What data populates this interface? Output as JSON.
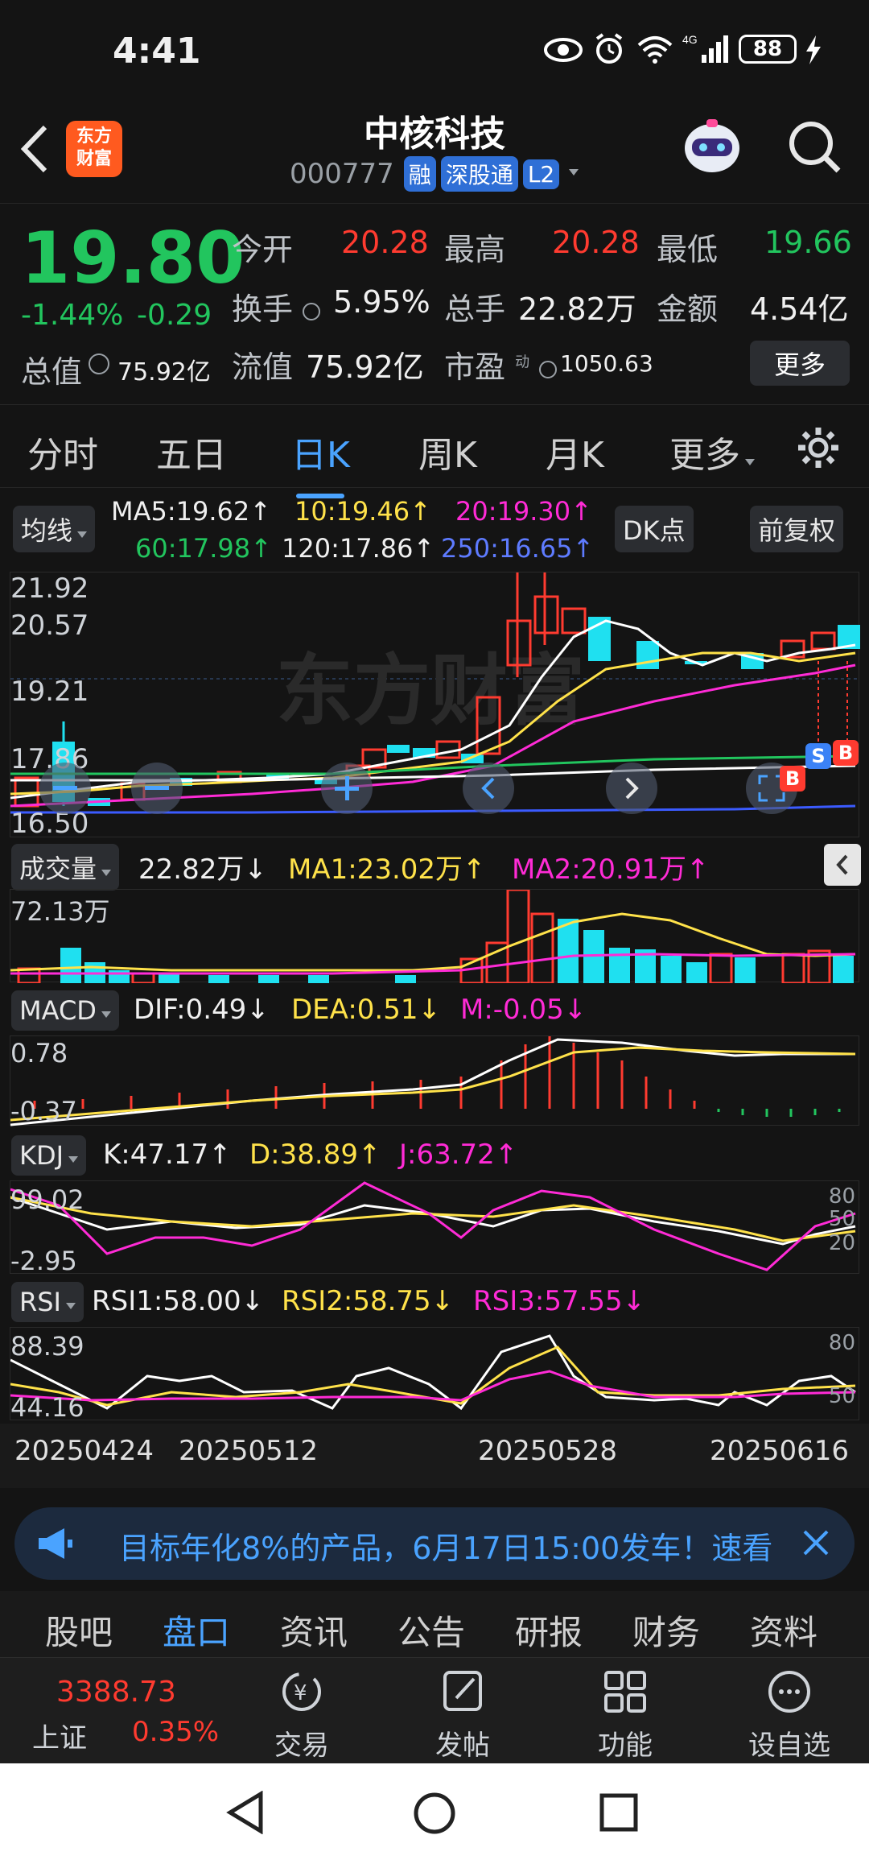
{
  "status_bar": {
    "time": "4:41",
    "battery": "88",
    "network": "4G"
  },
  "header": {
    "title": "中核科技",
    "code": "000777",
    "tags": [
      "融",
      "深股通",
      "L2"
    ],
    "logo_text_top": "东方",
    "logo_text_bottom": "财富"
  },
  "quote": {
    "price": "19.80",
    "change_pct": "-1.44%",
    "change_abs": "-0.29",
    "total_value_label": "总值",
    "total_value": "75.92亿",
    "stats": [
      {
        "label": "今开",
        "value": "20.28",
        "color": "#ff3b30"
      },
      {
        "label": "最高",
        "value": "20.28",
        "color": "#ff3b30"
      },
      {
        "label": "最低",
        "value": "19.66",
        "color": "#22c55e"
      },
      {
        "label": "换手",
        "value": "5.95%",
        "color": "#f0f0f0"
      },
      {
        "label": "总手",
        "value": "22.82万",
        "color": "#f0f0f0"
      },
      {
        "label": "金额",
        "value": "4.54亿",
        "color": "#f0f0f0"
      },
      {
        "label": "流值",
        "value": "75.92亿",
        "color": "#f0f0f0"
      },
      {
        "label": "市盈",
        "value": "1050.63",
        "color": "#f0f0f0"
      }
    ],
    "pe_sup": "动",
    "more_button": "更多"
  },
  "tabs": {
    "items": [
      "分时",
      "五日",
      "日K",
      "周K",
      "月K",
      "更多"
    ],
    "active": "日K"
  },
  "ma_panel": {
    "selector": "均线",
    "ma5": "MA5:19.62↑",
    "ma10": "10:19.46↑",
    "ma20": "20:19.30↑",
    "ma60": "60:17.98↑",
    "ma120": "120:17.86↑",
    "ma250": "250:16.65↑",
    "dk_button": "DK点",
    "fq_button": "前复权"
  },
  "kline": {
    "axis_labels": [
      "21.92",
      "20.57",
      "19.21",
      "17.86",
      "16.50"
    ],
    "watermark": "东方财富",
    "markers": {
      "s": "S",
      "b": "B"
    }
  },
  "volume": {
    "selector": "成交量",
    "value": "22.82万↓",
    "ma1": "MA1:23.02万↑",
    "ma2": "MA2:20.91万↑",
    "max_label": "72.13万"
  },
  "macd": {
    "selector": "MACD",
    "dif": "DIF:0.49↓",
    "dea": "DEA:0.51↓",
    "m": "M:-0.05↓",
    "top_label": "0.78",
    "bottom_label": "-0.37"
  },
  "kdj": {
    "selector": "KDJ",
    "k": "K:47.17↑",
    "d": "D:38.89↑",
    "j": "J:63.72↑",
    "top_label": "99.02",
    "bottom_label": "-2.95",
    "right_labels": [
      "80",
      "50",
      "20"
    ]
  },
  "rsi": {
    "selector": "RSI",
    "rsi1": "RSI1:58.00↓",
    "rsi2": "RSI2:58.75↓",
    "rsi3": "RSI3:57.55↓",
    "top_label": "88.39",
    "bottom_label": "44.16",
    "right_labels": [
      "80",
      "50"
    ]
  },
  "dates": [
    "20250424",
    "20250512",
    "20250528",
    "20250616"
  ],
  "banner": {
    "text": "目标年化8%的产品，6月17日15:00发车！速看"
  },
  "section_tabs": {
    "items": [
      "股吧",
      "盘口",
      "资讯",
      "公告",
      "研报",
      "财务",
      "资料"
    ],
    "active": "盘口"
  },
  "bottom_bar": {
    "index_value": "3388.73",
    "index_name": "上证",
    "index_change": "0.35%",
    "items": [
      "交易",
      "发帖",
      "功能",
      "设自选"
    ]
  },
  "colors": {
    "up": "#ff3b30",
    "down": "#1fe0f0",
    "accent": "#4aa3ff",
    "ma5": "#ffffff",
    "ma10": "#ffe24a",
    "ma20": "#ff2bd6",
    "ma60": "#22c55e",
    "ma250": "#3b5bff"
  }
}
